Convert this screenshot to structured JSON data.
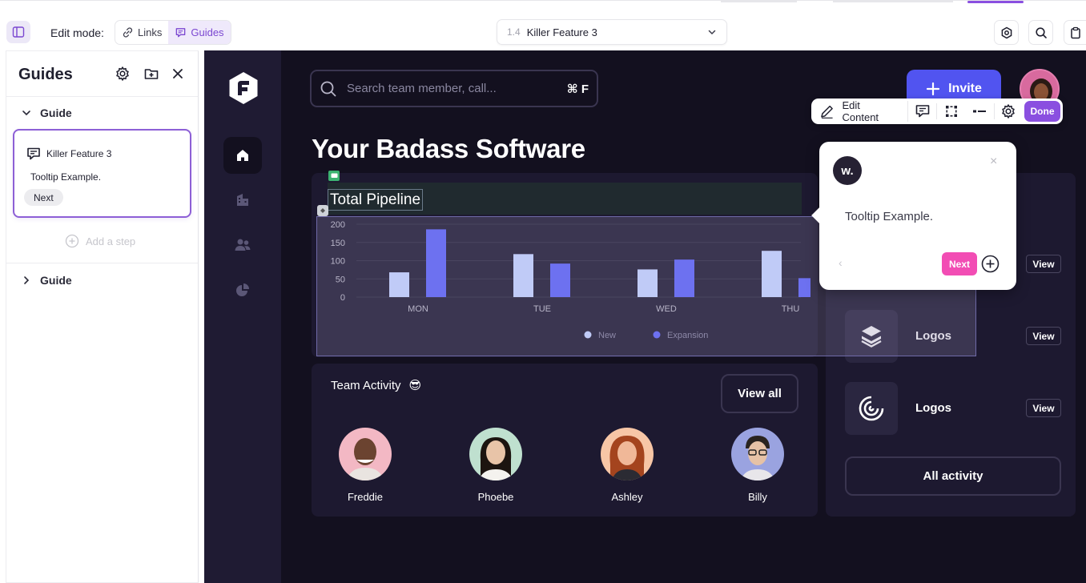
{
  "editor": {
    "edit_mode_label": "Edit mode:",
    "mode_links": "Links",
    "mode_guides": "Guides",
    "page_number": "1.4",
    "page_title": "Killer Feature 3"
  },
  "guides_panel": {
    "title": "Guides",
    "sections": [
      "Guide",
      "Guide"
    ],
    "step": {
      "title": "Killer Feature 3",
      "body": "Tooltip Example.",
      "next_label": "Next"
    },
    "add_step_label": "Add a step"
  },
  "app": {
    "search_placeholder": "Search team member, call...",
    "search_shortcut": "⌘ F",
    "invite_label": "Invite",
    "page_title": "Your Badass Software",
    "pipeline_title": "Total Pipeline",
    "team_title": "Team Activity",
    "team_emoji": "😎",
    "view_all_label": "View all",
    "members": [
      {
        "name": "Freddie",
        "bg": "#f3b8c4",
        "skin": "#6b4330"
      },
      {
        "name": "Phoebe",
        "bg": "#bfe0cf",
        "skin": "#e8c4a8"
      },
      {
        "name": "Ashley",
        "bg": "#f7c6a6",
        "skin": "#f0b898"
      },
      {
        "name": "Billy",
        "bg": "#9aa3e0",
        "skin": "#e6c2a6"
      }
    ],
    "side_items": [
      {
        "name": "Logos",
        "view": "View"
      },
      {
        "name": "Logos",
        "view": "View"
      }
    ],
    "top_view_label": "View",
    "all_activity_label": "All activity"
  },
  "edit_toolbar": {
    "edit_content_label": "Edit Content",
    "done_label": "Done"
  },
  "tooltip": {
    "logo_letter": "w.",
    "close": "×",
    "body": "Tooltip Example.",
    "back": "‹",
    "next_label": "Next"
  },
  "colors": {
    "accent": "#8a4fe0",
    "invite": "#5154f0",
    "tooltip_next": "#f24db4",
    "series_new": "#c0cbf7",
    "series_expansion": "#6d71f0"
  },
  "chart_data": {
    "type": "bar",
    "categories": [
      "MON",
      "TUE",
      "WED",
      "THU"
    ],
    "series": [
      {
        "name": "New",
        "values": [
          68,
          118,
          76,
          127
        ]
      },
      {
        "name": "Expansion",
        "values": [
          186,
          92,
          103,
          52
        ]
      }
    ],
    "ylim": [
      0,
      200
    ],
    "yticks": [
      0,
      50,
      100,
      150,
      200
    ],
    "legend": "bottom-center",
    "grid": true
  }
}
